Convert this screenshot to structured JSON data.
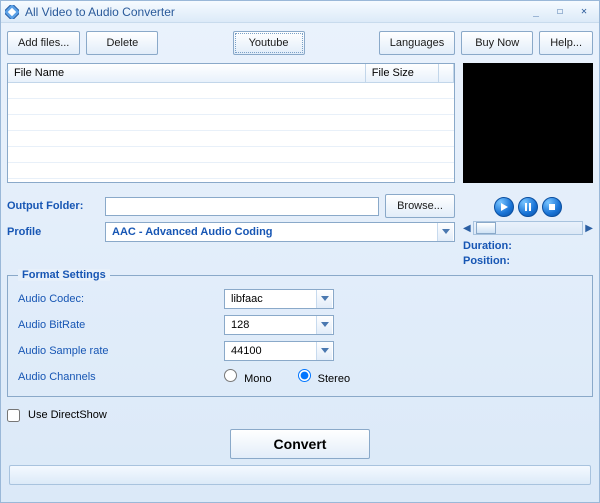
{
  "title": "All Video to Audio Converter",
  "toolbar": {
    "add_files": "Add files...",
    "delete": "Delete",
    "youtube": "Youtube",
    "languages": "Languages",
    "buy_now": "Buy Now",
    "help": "Help..."
  },
  "columns": {
    "name": "File Name",
    "size": "File Size"
  },
  "preview": {
    "duration_label": "Duration:",
    "position_label": "Position:"
  },
  "output_folder": {
    "label": "Output Folder:",
    "value": "",
    "browse": "Browse..."
  },
  "profile": {
    "label": "Profile",
    "value": "AAC - Advanced Audio Coding"
  },
  "format_settings": {
    "legend": "Format Settings",
    "codec_label": "Audio Codec:",
    "codec_value": "libfaac",
    "bitrate_label": "Audio BitRate",
    "bitrate_value": "128",
    "sample_label": "Audio Sample rate",
    "sample_value": "44100",
    "channels_label": "Audio Channels",
    "mono_label": "Mono",
    "stereo_label": "Stereo",
    "channels_selected": "stereo"
  },
  "use_directshow_label": "Use DirectShow",
  "convert_label": "Convert"
}
